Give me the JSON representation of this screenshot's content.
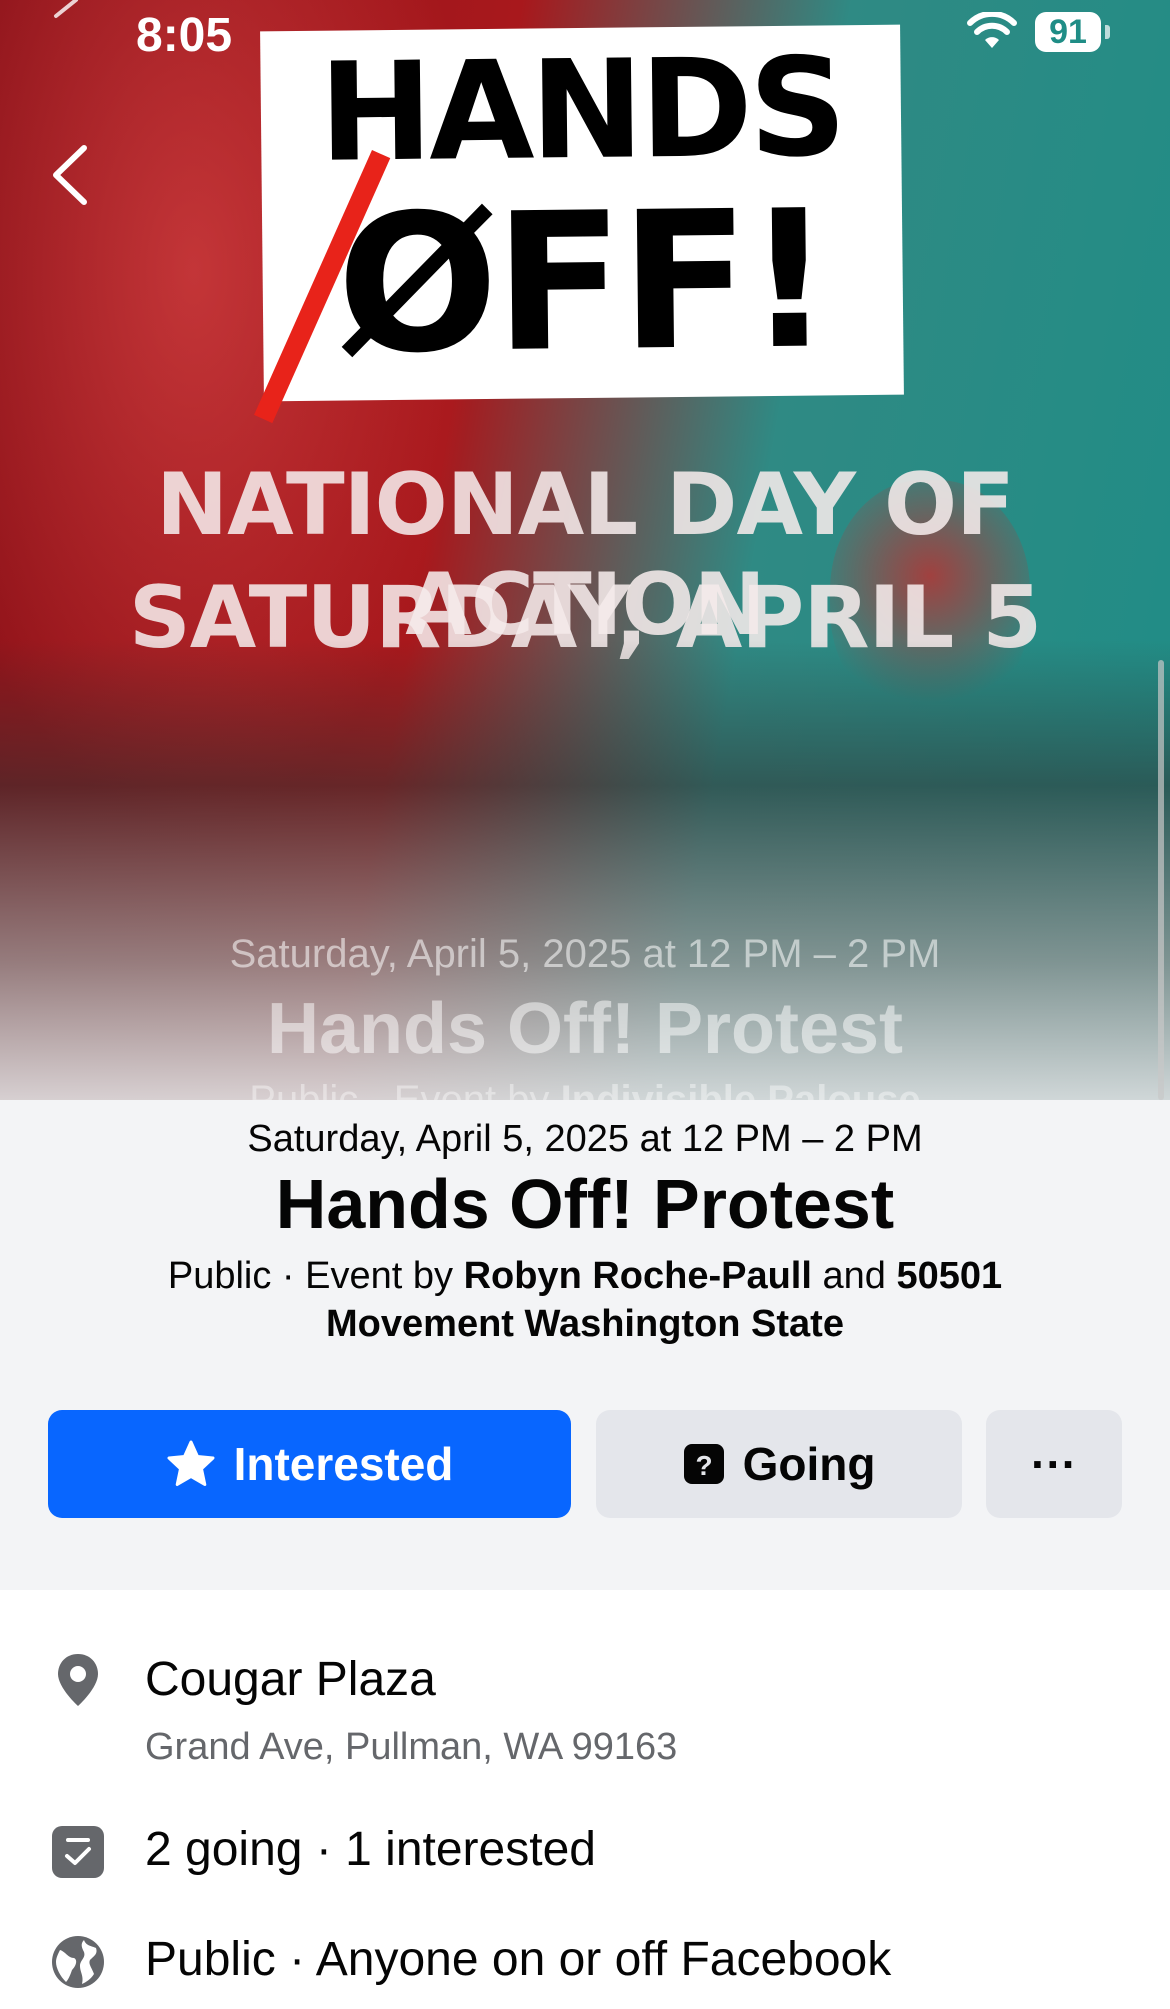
{
  "status_bar": {
    "time": "8:05",
    "battery": "91"
  },
  "cover": {
    "logo_line1": "HANDS",
    "logo_line2": "ØFF!",
    "headline1": "NATIONAL DAY OF ACTION",
    "headline2": "SATURDAY, APRIL 5"
  },
  "ghost_header": {
    "date": "Saturday, April 5, 2025 at 12 PM – 2 PM",
    "title": "Hands Off! Protest",
    "subtitle_prefix": "Public · Event by",
    "host": "Indivisible Palouse"
  },
  "event": {
    "date": "Saturday, April 5, 2025 at 12 PM – 2 PM",
    "title": "Hands Off! Protest",
    "privacy": "Public",
    "by_prefix": " · Event by ",
    "host1": "Robyn Roche-Paull",
    "and": " and ",
    "host2": "50501 Movement Washington State"
  },
  "actions": {
    "interested_label": "Interested",
    "going_label": "Going",
    "more_label": "···"
  },
  "details": {
    "location_name": "Cougar Plaza",
    "location_address": "Grand Ave, Pullman, WA 99163",
    "attendance": "2 going · 1 interested",
    "visibility": "Public · Anyone on or off Facebook"
  },
  "colors": {
    "primary_button": "#0866ff",
    "secondary_button": "#e4e6eb",
    "secondary_text": "#65676b",
    "logo_slash": "#e8231a"
  },
  "icons": {
    "back": "chevron-left-icon",
    "interested": "star-icon",
    "going": "question-calendar-icon",
    "more": "more-dots-icon",
    "location": "location-pin-icon",
    "attendance": "calendar-check-icon",
    "visibility": "globe-icon",
    "wifi": "wifi-icon"
  }
}
